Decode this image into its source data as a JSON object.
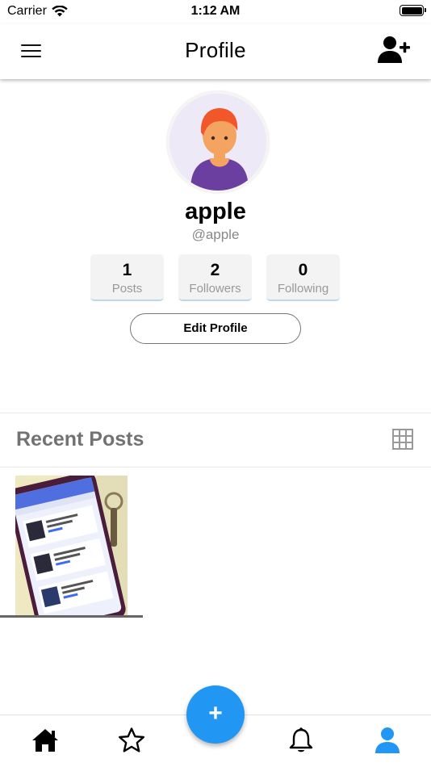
{
  "status_bar": {
    "carrier": "Carrier",
    "time": "1:12 AM"
  },
  "app_bar": {
    "title": "Profile",
    "menu_icon": "hamburger-menu-icon",
    "add_user_icon": "add-user-icon"
  },
  "profile": {
    "name": "apple",
    "handle": "@apple",
    "stats": [
      {
        "value": "1",
        "label": "Posts"
      },
      {
        "value": "2",
        "label": "Followers"
      },
      {
        "value": "0",
        "label": "Following"
      }
    ],
    "edit_label": "Edit Profile"
  },
  "recent_posts": {
    "title": "Recent Posts",
    "grid_icon": "grid-icon",
    "posts": [
      {
        "thumbnail": "phone-screenshot-photo"
      }
    ]
  },
  "fab": {
    "label": "+",
    "icon": "plus-icon"
  },
  "bottom_nav": {
    "items": [
      {
        "icon": "home-icon",
        "active": false
      },
      {
        "icon": "star-icon",
        "active": false
      },
      {
        "icon": "bell-icon",
        "active": false
      },
      {
        "icon": "person-icon",
        "active": true
      }
    ]
  },
  "colors": {
    "accent": "#2196f3",
    "title_gray": "#727272",
    "stat_bg": "#f3f3f3",
    "avatar_bg": "#ede9f6"
  }
}
